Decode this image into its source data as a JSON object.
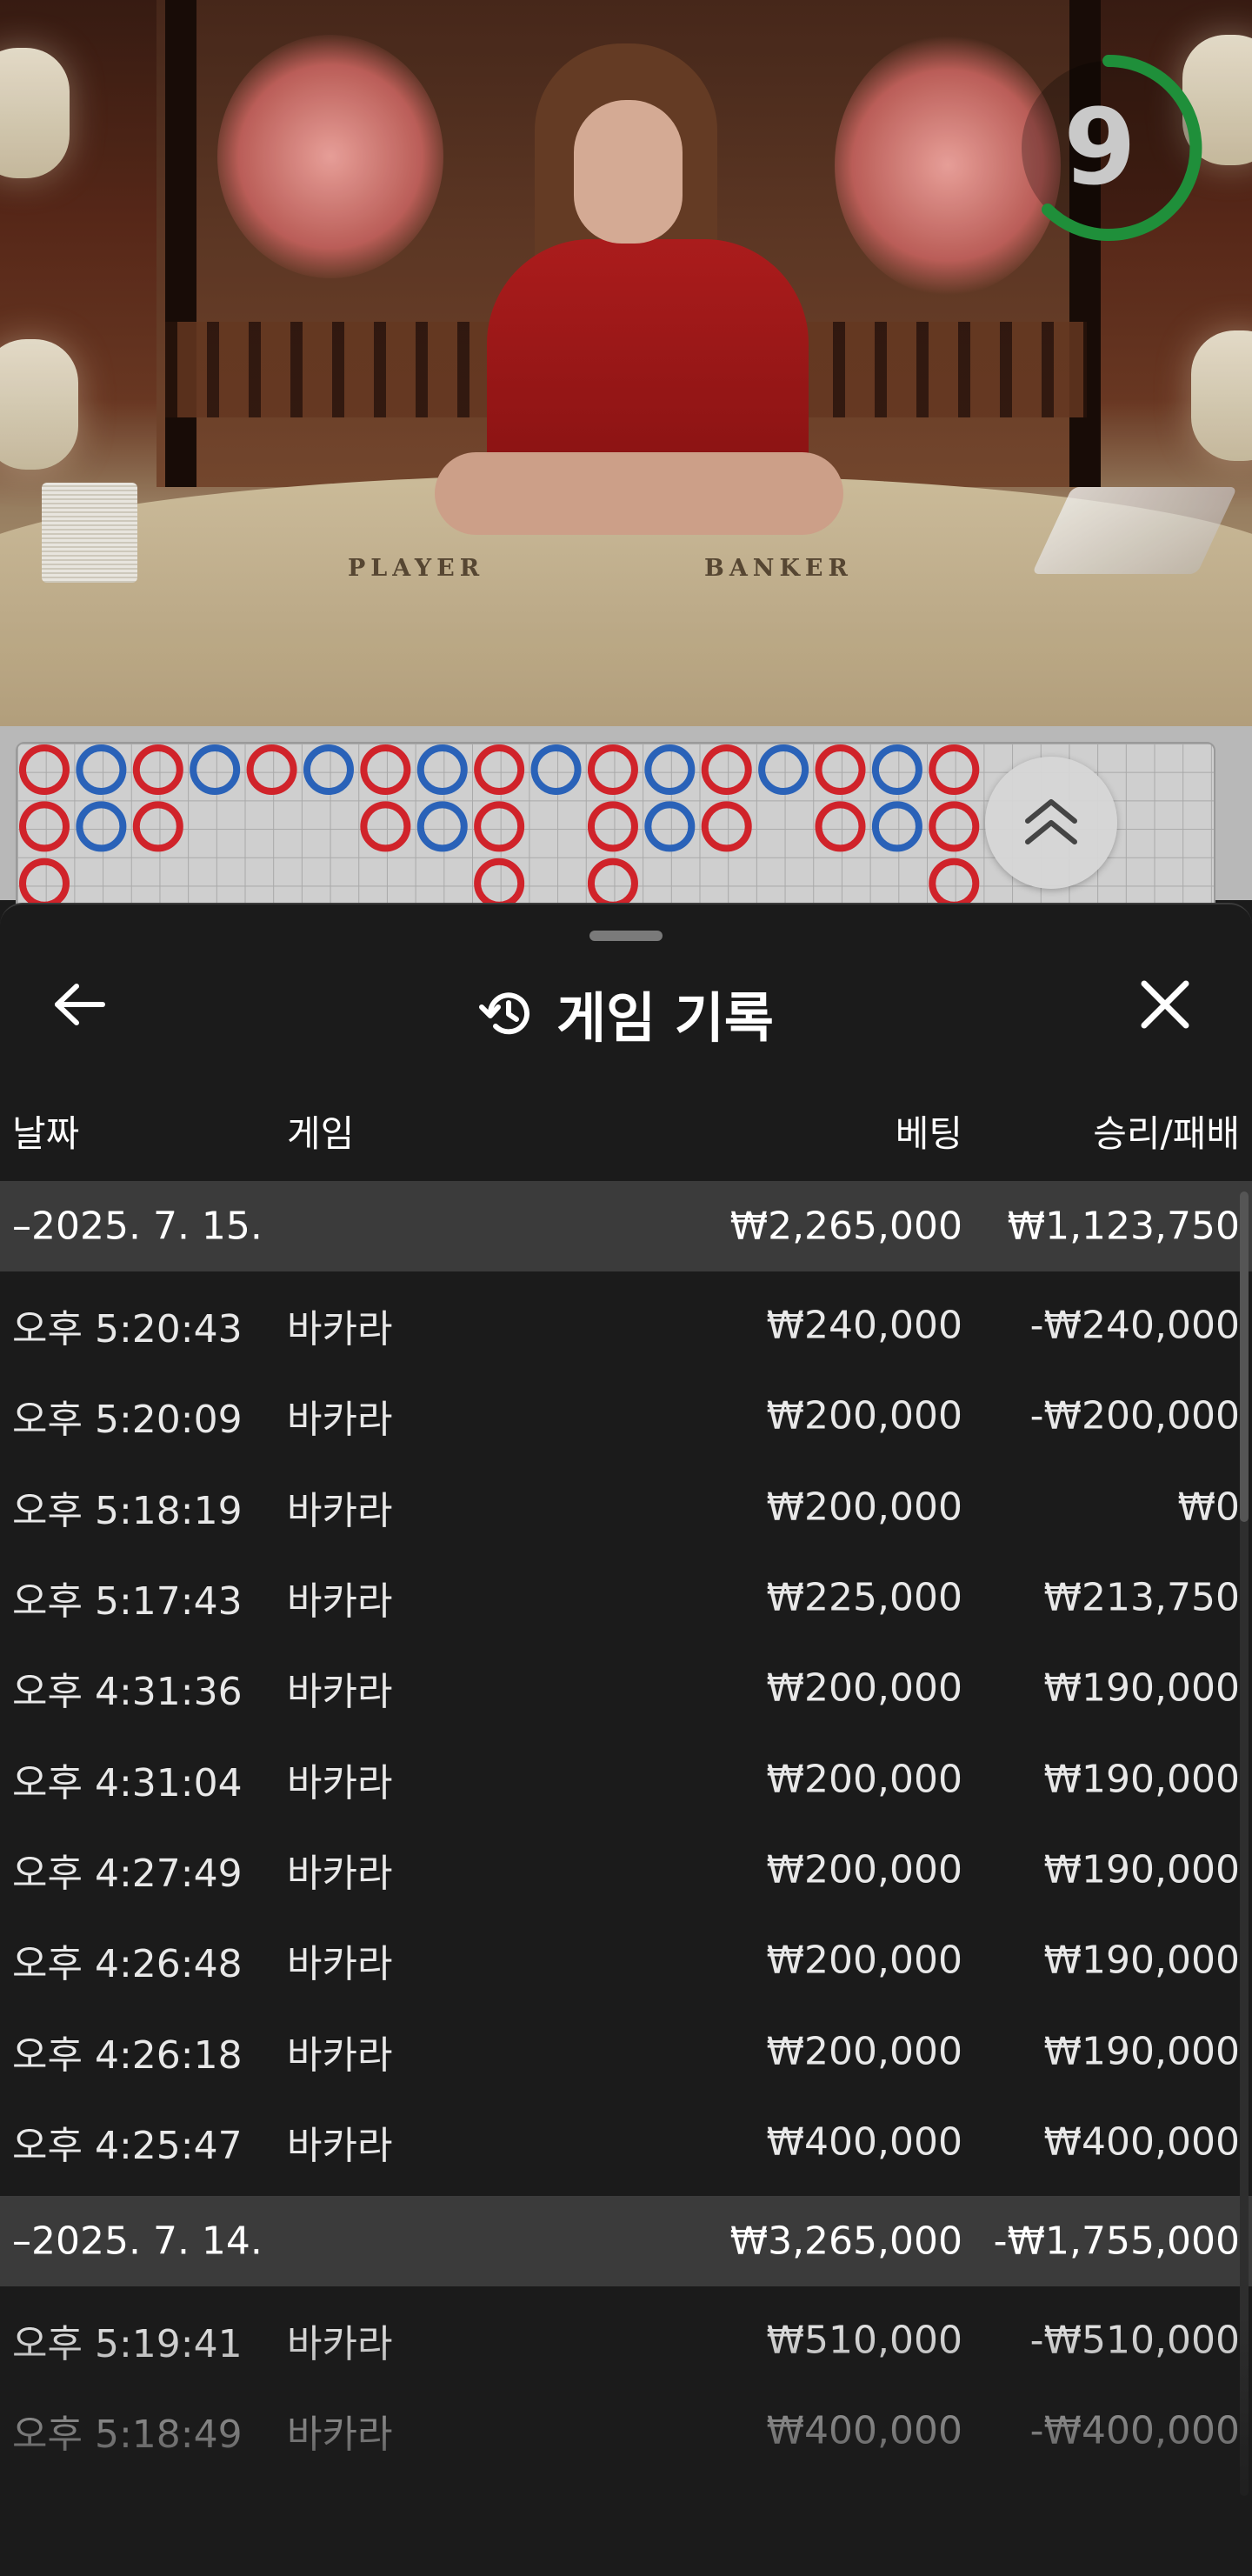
{
  "video": {
    "countdown": "9",
    "table_player_label": "PLAYER",
    "table_banker_label": "BANKER"
  },
  "roadmap": {
    "columns": [
      [
        "B",
        "B",
        "B"
      ],
      [
        "P",
        "P"
      ],
      [
        "B",
        "B"
      ],
      [
        "P"
      ],
      [
        "B"
      ],
      [
        "P"
      ],
      [
        "B",
        "B"
      ],
      [
        "P",
        "P"
      ],
      [
        "B",
        "B",
        "B"
      ],
      [
        "P"
      ],
      [
        "B",
        "B",
        "B"
      ],
      [
        "P",
        "P"
      ],
      [
        "B",
        "B"
      ],
      [
        "P"
      ],
      [
        "B",
        "B"
      ],
      [
        "P",
        "P"
      ],
      [
        "B",
        "B",
        "B"
      ]
    ],
    "colors": {
      "banker": "#d0232a",
      "player": "#2a62b8"
    }
  },
  "panel": {
    "title": "게임 기록",
    "icons": {
      "back": "arrow-left-icon",
      "history": "history-icon",
      "close": "close-icon",
      "scroll_up": "chevron-double-up-icon"
    },
    "columns": {
      "date": "날짜",
      "game": "게임",
      "bet": "베팅",
      "winloss": "승리/패배"
    },
    "groups": [
      {
        "date": "–2025. 7. 15.",
        "bet_total": "₩2,265,000",
        "win_total": "₩1,123,750",
        "rows": [
          {
            "time": "오후 5:20:43",
            "game": "바카라",
            "bet": "₩240,000",
            "win": "-₩240,000"
          },
          {
            "time": "오후 5:20:09",
            "game": "바카라",
            "bet": "₩200,000",
            "win": "-₩200,000"
          },
          {
            "time": "오후 5:18:19",
            "game": "바카라",
            "bet": "₩200,000",
            "win": "₩0"
          },
          {
            "time": "오후 5:17:43",
            "game": "바카라",
            "bet": "₩225,000",
            "win": "₩213,750"
          },
          {
            "time": "오후 4:31:36",
            "game": "바카라",
            "bet": "₩200,000",
            "win": "₩190,000"
          },
          {
            "time": "오후 4:31:04",
            "game": "바카라",
            "bet": "₩200,000",
            "win": "₩190,000"
          },
          {
            "time": "오후 4:27:49",
            "game": "바카라",
            "bet": "₩200,000",
            "win": "₩190,000"
          },
          {
            "time": "오후 4:26:48",
            "game": "바카라",
            "bet": "₩200,000",
            "win": "₩190,000"
          },
          {
            "time": "오후 4:26:18",
            "game": "바카라",
            "bet": "₩200,000",
            "win": "₩190,000"
          },
          {
            "time": "오후 4:25:47",
            "game": "바카라",
            "bet": "₩400,000",
            "win": "₩400,000"
          }
        ]
      },
      {
        "date": "–2025. 7. 14.",
        "bet_total": "₩3,265,000",
        "win_total": "-₩1,755,000",
        "rows": [
          {
            "time": "오후 5:19:41",
            "game": "바카라",
            "bet": "₩510,000",
            "win": "-₩510,000"
          },
          {
            "time": "오후 5:18:49",
            "game": "바카라",
            "bet": "₩400,000",
            "win": "-₩400,000"
          }
        ]
      }
    ]
  }
}
